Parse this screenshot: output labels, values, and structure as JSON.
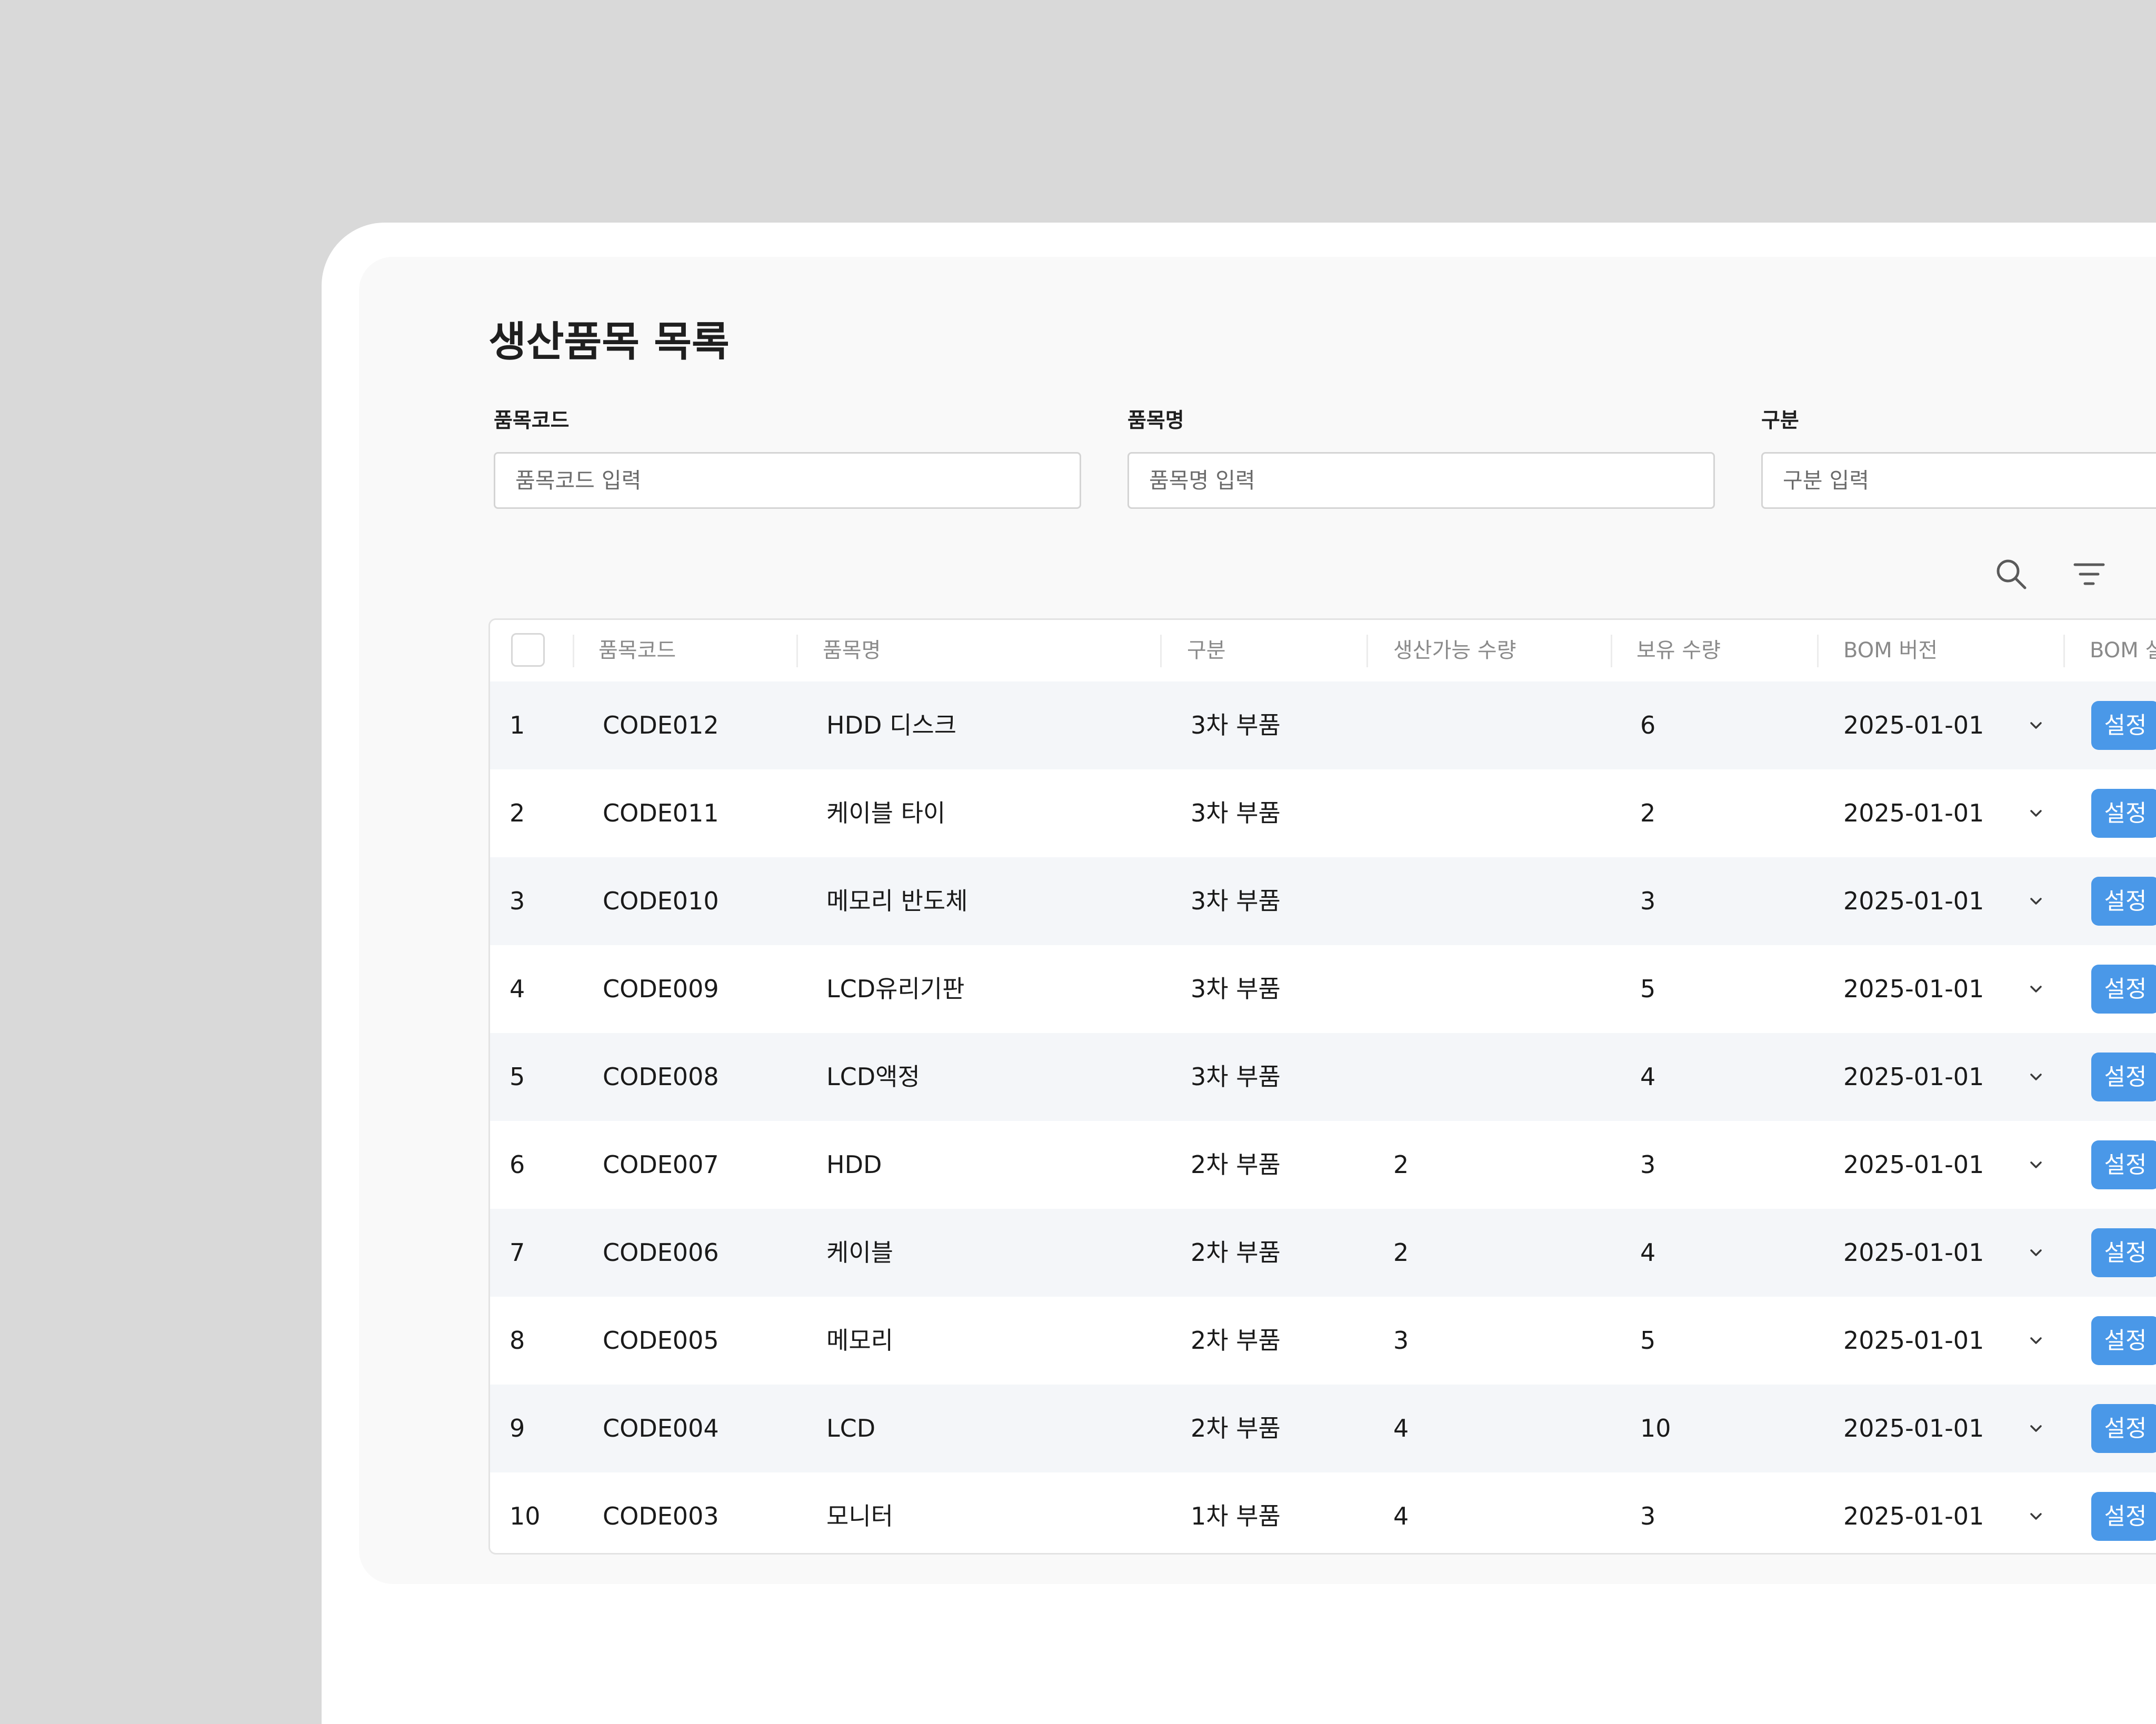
{
  "page": {
    "title": "생산품목 목록"
  },
  "filters": [
    {
      "label": "품목코드",
      "placeholder": "품목코드 입력"
    },
    {
      "label": "품목명",
      "placeholder": "품목명 입력"
    },
    {
      "label": "구분",
      "placeholder": "구분 입력"
    }
  ],
  "toolbar": {
    "icons": [
      "search-icon",
      "filter-icon"
    ]
  },
  "table": {
    "columns": [
      "품목코드",
      "품목명",
      "구분",
      "생산가능 수량",
      "보유 수량",
      "BOM 버전",
      "BOM 설정"
    ],
    "rows": [
      {
        "no": "1",
        "code": "CODE012",
        "name": "HDD 디스크",
        "type": "3차 부품",
        "producible": "",
        "stock": "6",
        "bom_version": "2025-01-01",
        "action": "설정"
      },
      {
        "no": "2",
        "code": "CODE011",
        "name": "케이블 타이",
        "type": "3차 부품",
        "producible": "",
        "stock": "2",
        "bom_version": "2025-01-01",
        "action": "설정"
      },
      {
        "no": "3",
        "code": "CODE010",
        "name": "메모리 반도체",
        "type": "3차 부품",
        "producible": "",
        "stock": "3",
        "bom_version": "2025-01-01",
        "action": "설정"
      },
      {
        "no": "4",
        "code": "CODE009",
        "name": "LCD유리기판",
        "type": "3차 부품",
        "producible": "",
        "stock": "5",
        "bom_version": "2025-01-01",
        "action": "설정"
      },
      {
        "no": "5",
        "code": "CODE008",
        "name": "LCD액정",
        "type": "3차 부품",
        "producible": "",
        "stock": "4",
        "bom_version": "2025-01-01",
        "action": "설정"
      },
      {
        "no": "6",
        "code": "CODE007",
        "name": "HDD",
        "type": "2차 부품",
        "producible": "2",
        "stock": "3",
        "bom_version": "2025-01-01",
        "action": "설정"
      },
      {
        "no": "7",
        "code": "CODE006",
        "name": "케이블",
        "type": "2차 부품",
        "producible": "2",
        "stock": "4",
        "bom_version": "2025-01-01",
        "action": "설정"
      },
      {
        "no": "8",
        "code": "CODE005",
        "name": "메모리",
        "type": "2차 부품",
        "producible": "3",
        "stock": "5",
        "bom_version": "2025-01-01",
        "action": "설정"
      },
      {
        "no": "9",
        "code": "CODE004",
        "name": "LCD",
        "type": "2차 부품",
        "producible": "4",
        "stock": "10",
        "bom_version": "2025-01-01",
        "action": "설정"
      },
      {
        "no": "10",
        "code": "CODE003",
        "name": "모니터",
        "type": "1차 부품",
        "producible": "4",
        "stock": "3",
        "bom_version": "2025-01-01",
        "action": "설정"
      }
    ]
  },
  "colors": {
    "background": "#d9d9d9",
    "panel": "#f9f9f9",
    "accent": "#4a98e8",
    "row_alt": "#f4f6f9",
    "header_text": "#8a8a8a"
  }
}
